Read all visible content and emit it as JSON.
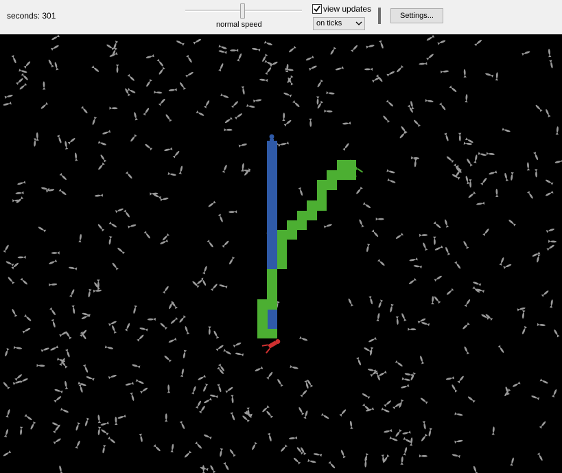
{
  "toolbar": {
    "ticks_label": "seconds: 301",
    "speed_label": "normal speed",
    "speed_level": 0.5,
    "view_updates_label": "view updates",
    "view_updates_checked": true,
    "update_mode": "on ticks",
    "settings_label": "Settings..."
  },
  "world": {
    "background": "#000000",
    "colors": {
      "fish": "#9a9a9a",
      "blue_agent": "#2f5aa8",
      "green_agent": "#4caf32",
      "red_agent": "#d03030"
    },
    "agents": [
      {
        "name": "blue-agent",
        "icon": "person-icon"
      },
      {
        "name": "green-agent",
        "icon": "person-icon"
      },
      {
        "name": "red-agent",
        "icon": "person-icon"
      }
    ],
    "fish_icon": "fish-icon"
  }
}
